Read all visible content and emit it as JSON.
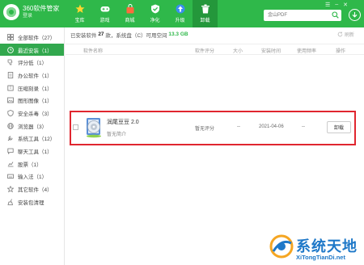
{
  "app": {
    "title": "360软件管家",
    "subtitle": "登录"
  },
  "nav": [
    {
      "label": "宝库",
      "icon": "star-icon"
    },
    {
      "label": "游戏",
      "icon": "gamepad-icon"
    },
    {
      "label": "商城",
      "icon": "shopping-bag-icon"
    },
    {
      "label": "净化",
      "icon": "shield-icon"
    },
    {
      "label": "升级",
      "icon": "arrow-up-icon"
    },
    {
      "label": "卸载",
      "icon": "trash-icon"
    }
  ],
  "search": {
    "placeholder": "金山PDF"
  },
  "sidebar": {
    "items": [
      {
        "label": "全部软件（27）",
        "icon": "grid-icon"
      },
      {
        "label": "最近安装（1）",
        "icon": "clock-icon"
      },
      {
        "label": "评分低（1）",
        "icon": "thumbs-down-icon"
      },
      {
        "label": "办公软件（1）",
        "icon": "document-icon"
      },
      {
        "label": "压缩刻录（1）",
        "icon": "archive-icon"
      },
      {
        "label": "图形图像（1）",
        "icon": "image-icon"
      },
      {
        "label": "安全杀毒（3）",
        "icon": "shield-icon"
      },
      {
        "label": "浏览器（3）",
        "icon": "globe-icon"
      },
      {
        "label": "系统工具（12）",
        "icon": "wrench-icon"
      },
      {
        "label": "聊天工具（1）",
        "icon": "chat-icon"
      },
      {
        "label": "股票（1）",
        "icon": "chart-icon"
      },
      {
        "label": "输入法（1）",
        "icon": "keyboard-icon"
      },
      {
        "label": "其它软件（4）",
        "icon": "star-icon"
      },
      {
        "label": "安装包清理",
        "icon": "broom-icon"
      }
    ]
  },
  "info": {
    "prefix": "已安装软件",
    "count": "27",
    "middle": "款，系统盘（C）可用空间",
    "free_space": "13.3 GB",
    "refresh_label": "刷新"
  },
  "table": {
    "headers": [
      "软件名称",
      "软件评分",
      "大小",
      "安装时间",
      "使用频率",
      "操作"
    ],
    "row": {
      "name": "润尾豆豆 2.0",
      "desc": "暂无简介",
      "rating": "暂无评分",
      "size": "--",
      "install_date": "2021-04-06",
      "frequency": "--",
      "action": "卸载"
    }
  },
  "watermark": {
    "text": "系统天地",
    "url": "XiTongTianDi.net"
  },
  "colors": {
    "brand": "#2fb84a",
    "highlight": "#e0262f",
    "watermark": "#1e78c8"
  }
}
